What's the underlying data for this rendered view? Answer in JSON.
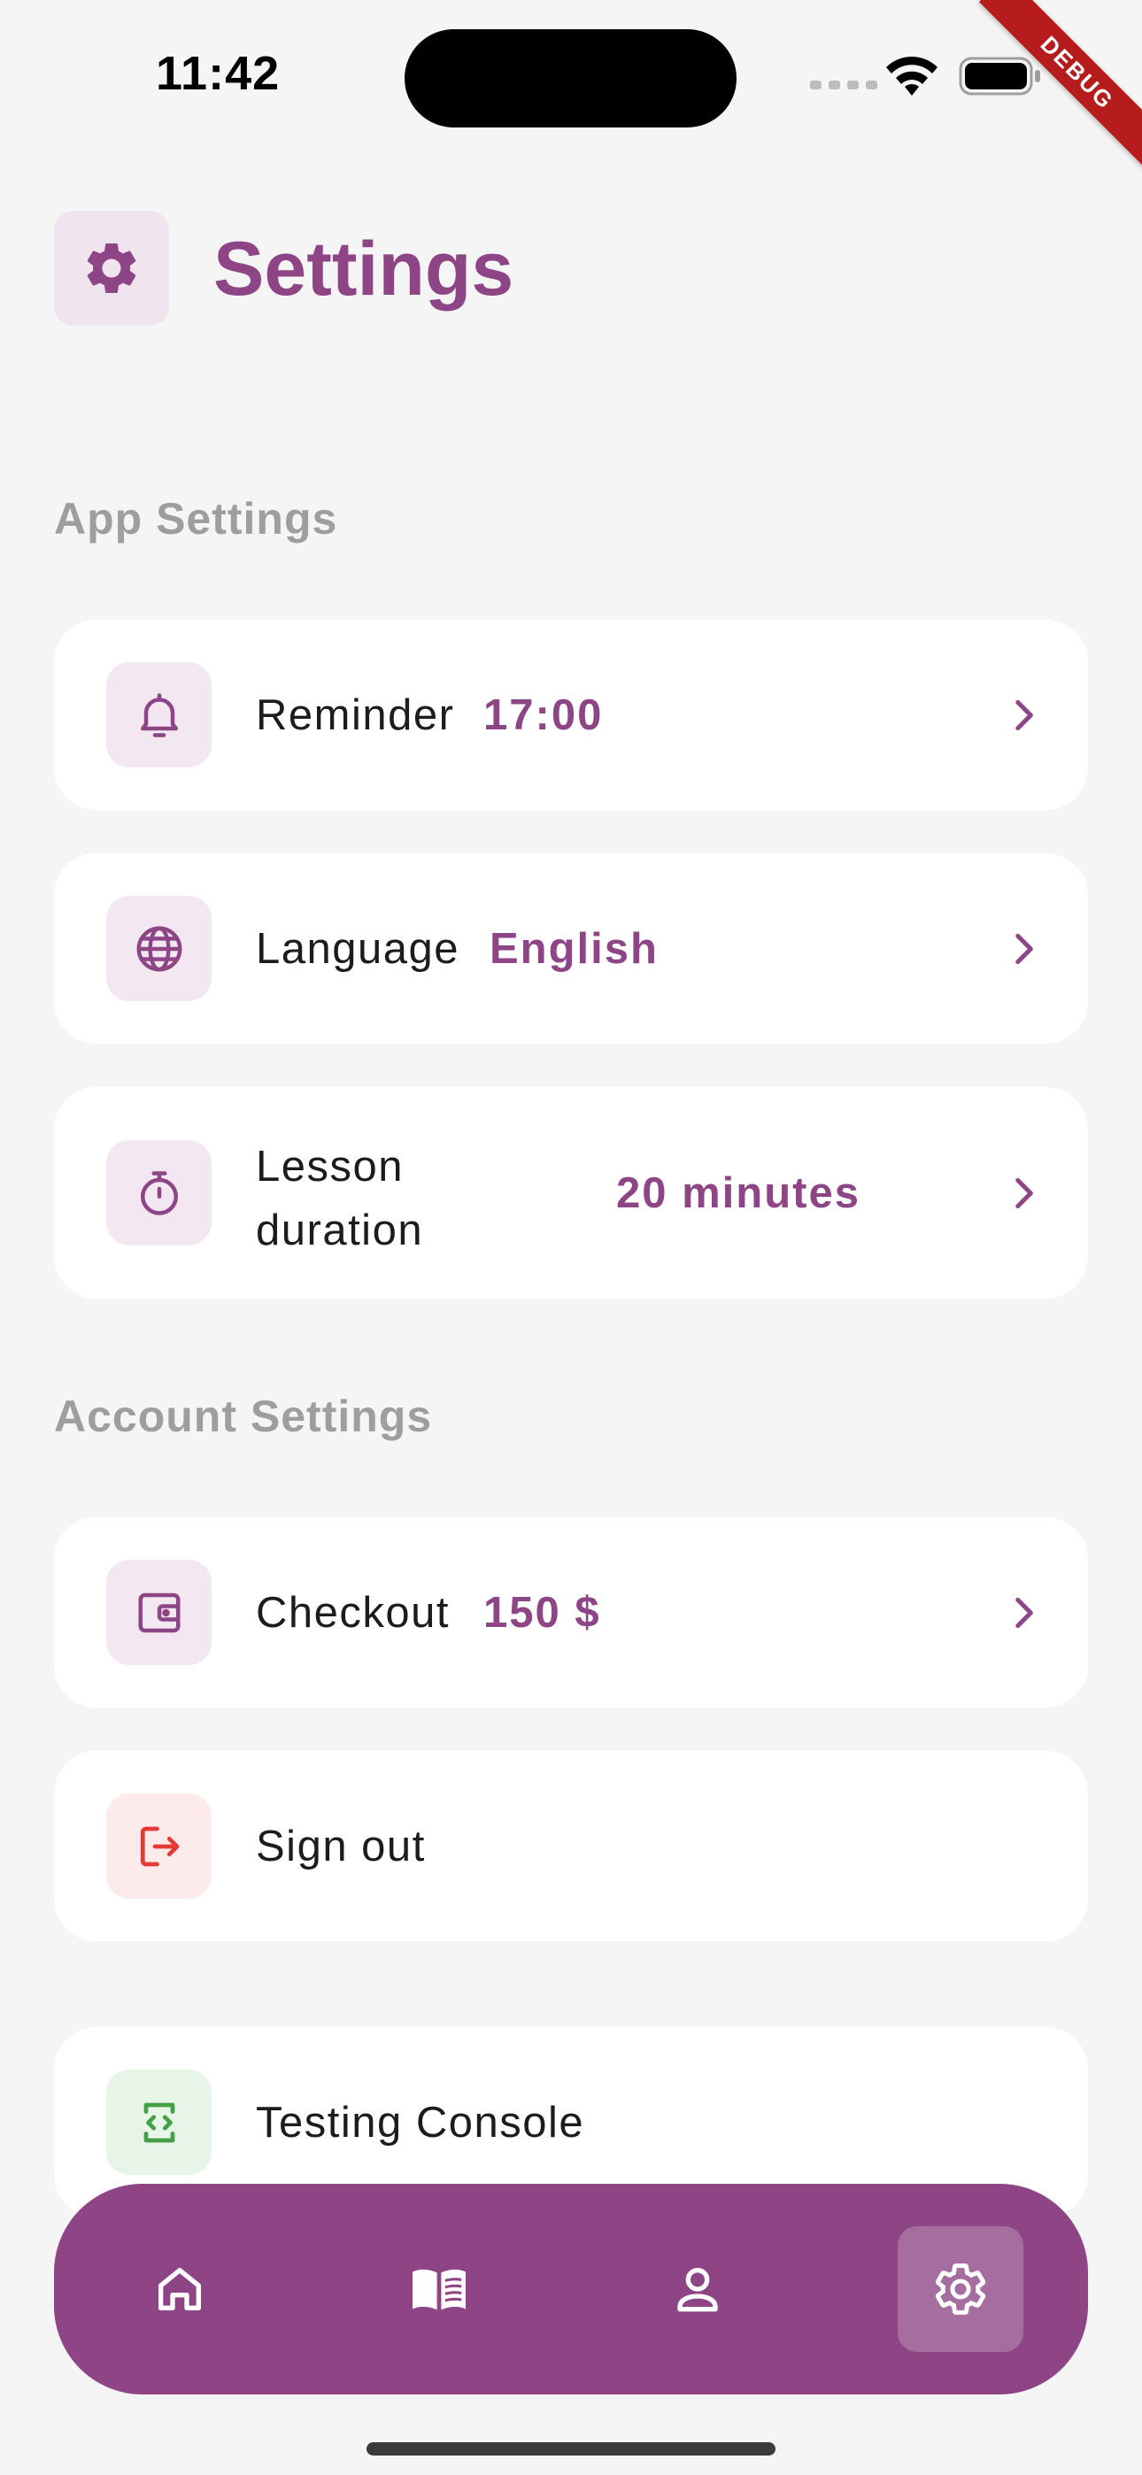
{
  "status_bar": {
    "time": "11:42"
  },
  "debug_banner": "DEBUG",
  "page": {
    "title": "Settings"
  },
  "sections": {
    "app": "App Settings",
    "account": "Account Settings"
  },
  "items": {
    "reminder": {
      "label": "Reminder",
      "value": "17:00",
      "icon": "bell-icon"
    },
    "language": {
      "label": "Language",
      "value": "English",
      "icon": "globe-icon"
    },
    "lesson": {
      "label_line1": "Lesson",
      "label_line2": "duration",
      "value": "20 minutes",
      "icon": "stopwatch-icon"
    },
    "checkout": {
      "label": "Checkout",
      "value": "150 $",
      "icon": "wallet-icon"
    },
    "signout": {
      "label": "Sign out",
      "icon": "logout-icon"
    },
    "testing": {
      "label": "Testing Console",
      "icon": "code-device-icon"
    }
  },
  "bottom_nav": {
    "items": [
      {
        "name": "home",
        "icon": "home-icon",
        "active": false
      },
      {
        "name": "lessons",
        "icon": "book-icon",
        "active": false
      },
      {
        "name": "profile",
        "icon": "person-icon",
        "active": false
      },
      {
        "name": "settings",
        "icon": "gear-icon",
        "active": true
      }
    ]
  },
  "colors": {
    "accent": "#8e4585",
    "danger": "#e53935",
    "success": "#43a047",
    "section_title": "#9e9e9e",
    "background": "#f5f5f5"
  }
}
